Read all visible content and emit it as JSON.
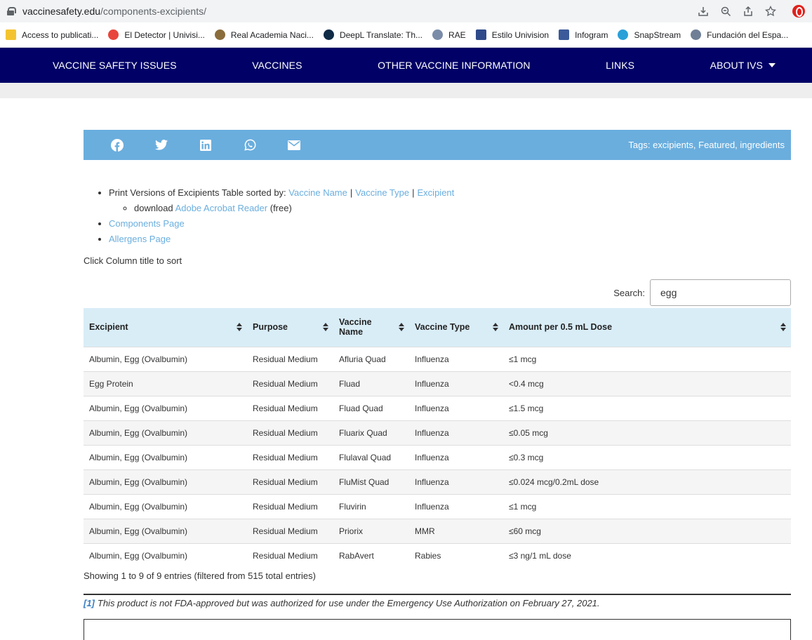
{
  "browser": {
    "url_domain": "vaccinesafety.edu",
    "url_path": "/components-excipients/",
    "bookmarks": [
      {
        "label": "Access to publicati...",
        "color": "#f4c430"
      },
      {
        "label": "El Detector | Univisi...",
        "color": "#e8453c"
      },
      {
        "label": "Real Academia Naci...",
        "color": "#8a6d3b"
      },
      {
        "label": "DeepL Translate: Th...",
        "color": "#0f2b46"
      },
      {
        "label": "RAE",
        "color": "#7a8ca8"
      },
      {
        "label": "Estilo Univision",
        "color": "#2f4a8a"
      },
      {
        "label": "Infogram",
        "color": "#3a5a9a"
      },
      {
        "label": "SnapStream",
        "color": "#2aa0d8"
      },
      {
        "label": "Fundación del Espa...",
        "color": "#6f7f95"
      }
    ]
  },
  "nav": {
    "items": [
      "VACCINE SAFETY ISSUES",
      "VACCINES",
      "OTHER VACCINE INFORMATION",
      "LINKS",
      "ABOUT IVS"
    ]
  },
  "share": {
    "icons": [
      "facebook-icon",
      "twitter-icon",
      "linkedin-icon",
      "whatsapp-icon",
      "email-icon"
    ],
    "tags_label": "Tags:",
    "tags": [
      "excipients",
      "Featured",
      "ingredients"
    ],
    "tags_text": "Tags: excipients, Featured, ingredients"
  },
  "links": {
    "print_prefix": "Print Versions of Excipients Table sorted by:",
    "print_options": [
      "Vaccine Name",
      "Vaccine Type",
      "Excipient"
    ],
    "download_prefix": "download",
    "download_link": "Adobe Acrobat Reader",
    "download_suffix": "(free)",
    "components_page": "Components Page",
    "allergens_page": "Allergens Page"
  },
  "sort_hint": "Click Column title to sort",
  "search": {
    "label": "Search:",
    "value": "egg"
  },
  "table": {
    "headers": [
      "Excipient",
      "Purpose",
      "Vaccine Name",
      "Vaccine Type",
      "Amount per 0.5 mL Dose"
    ],
    "header_vaccine_name_line1": "Vaccine",
    "header_vaccine_name_line2": "Name",
    "rows": [
      [
        "Albumin, Egg (Ovalbumin)",
        "Residual Medium",
        "Afluria Quad",
        "Influenza",
        "≤1 mcg"
      ],
      [
        "Egg Protein",
        "Residual Medium",
        "Fluad",
        "Influenza",
        "<0.4 mcg"
      ],
      [
        "Albumin, Egg (Ovalbumin)",
        "Residual Medium",
        "Fluad Quad",
        "Influenza",
        "≤1.5 mcg"
      ],
      [
        "Albumin, Egg (Ovalbumin)",
        "Residual Medium",
        "Fluarix Quad",
        "Influenza",
        "≤0.05 mcg"
      ],
      [
        "Albumin, Egg (Ovalbumin)",
        "Residual Medium",
        "Flulaval Quad",
        "Influenza",
        "≤0.3 mcg"
      ],
      [
        "Albumin, Egg (Ovalbumin)",
        "Residual Medium",
        "FluMist Quad",
        "Influenza",
        "≤0.024 mcg/0.2mL dose"
      ],
      [
        "Albumin, Egg (Ovalbumin)",
        "Residual Medium",
        "Fluvirin",
        "Influenza",
        "≤1 mcg"
      ],
      [
        "Albumin, Egg (Ovalbumin)",
        "Residual Medium",
        "Priorix",
        "MMR",
        "≤60 mcg"
      ],
      [
        "Albumin, Egg (Ovalbumin)",
        "Residual Medium",
        "RabAvert",
        "Rabies",
        "≤3 ng/1 mL dose"
      ]
    ]
  },
  "info": "Showing 1 to 9 of 9 entries (filtered from 515 total entries)",
  "footnote": {
    "ref": "[1]",
    "text": "This product is not FDA-approved but was authorized for use under the Emergency Use Authorization on February 27, 2021."
  }
}
